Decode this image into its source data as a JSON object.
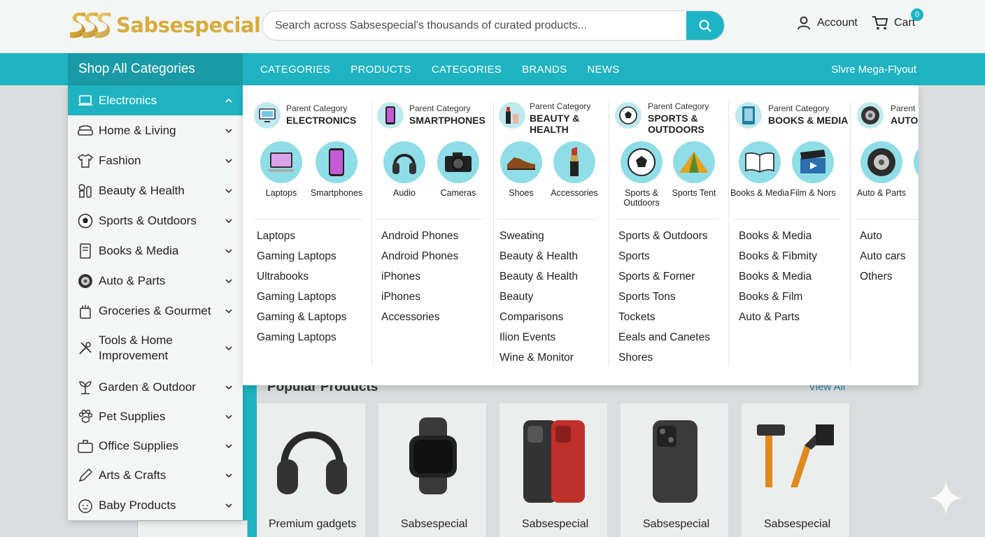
{
  "brand": {
    "name": "Sabsespecial"
  },
  "search": {
    "placeholder": "Search across Sabsespecial's thousands of curated products..."
  },
  "header": {
    "account_label": "Account",
    "cart_label": "Cart",
    "cart_count": "0"
  },
  "nav": {
    "shop_all": "Shop All Categories",
    "links": [
      "CATEGORIES",
      "PRODUCTS",
      "CATEGORIES",
      "BRANDS",
      "NEWS"
    ],
    "right_label": "Slvre Mega-Flyout"
  },
  "sidebar": {
    "items": [
      {
        "label": "Electronics",
        "icon": "laptop-icon"
      },
      {
        "label": "Home & Living",
        "icon": "sofa-icon"
      },
      {
        "label": "Fashion",
        "icon": "shirt-icon"
      },
      {
        "label": "Beauty & Health",
        "icon": "beauty-icon"
      },
      {
        "label": "Sports & Outdoors",
        "icon": "soccer-ball-icon"
      },
      {
        "label": "Books & Media",
        "icon": "book-icon"
      },
      {
        "label": "Auto & Parts",
        "icon": "tire-icon"
      },
      {
        "label": "Groceries & Gourmet",
        "icon": "grocery-bag-icon"
      },
      {
        "label": "Tools & Home Improvement",
        "icon": "tools-icon"
      },
      {
        "label": "Garden & Outdoor",
        "icon": "plant-icon"
      },
      {
        "label": "Pet Supplies",
        "icon": "paw-icon"
      },
      {
        "label": "Office Supplies",
        "icon": "briefcase-icon"
      },
      {
        "label": "Arts & Crafts",
        "icon": "pencil-icon"
      },
      {
        "label": "Baby Products",
        "icon": "baby-icon"
      }
    ]
  },
  "mega": {
    "columns": [
      {
        "parent_small": "Parent Category",
        "parent_name": "ELECTRONICS",
        "parent_icon": "monitor-icon",
        "subs": [
          {
            "label": "Laptops",
            "icon": "laptop-icon"
          },
          {
            "label": "Smartphones",
            "icon": "smartphone-icon"
          }
        ],
        "links": [
          "Laptops",
          "Gaming Laptops",
          "Ultrabooks",
          "Gaming Laptops",
          "Gaming & Laptops",
          "Gaming Laptops"
        ]
      },
      {
        "parent_small": "Parent Category",
        "parent_name": "SMARTPHONES",
        "parent_icon": "smartphone-icon",
        "subs": [
          {
            "label": "Audio",
            "icon": "headphones-icon"
          },
          {
            "label": "Cameras",
            "icon": "camera-icon"
          }
        ],
        "links": [
          "Android Phones",
          "Android Phones",
          "iPhones",
          "iPhones",
          "Accessories"
        ]
      },
      {
        "parent_small": "Parent Category",
        "parent_name": "BEAUTY & HEALTH",
        "parent_icon": "cosmetics-icon",
        "subs": [
          {
            "label": "Shoes",
            "icon": "shoe-icon"
          },
          {
            "label": "Accessories",
            "icon": "lipstick-icon"
          }
        ],
        "links": [
          "Sweating",
          "Beauty & Health",
          "Beauty & Health",
          "Beauty",
          "Comparisons",
          "Ilion Events",
          "Wine & Monitor"
        ]
      },
      {
        "parent_small": "Parent Category",
        "parent_name": "SPORTS & OUTDOORS",
        "parent_icon": "soccer-ball-icon",
        "subs": [
          {
            "label": "Sports & Outdoors",
            "icon": "soccer-ball-icon"
          },
          {
            "label": "Sports Tent",
            "icon": "tent-icon"
          }
        ],
        "links": [
          "Sports & Outdoors",
          "Sports",
          "Sports & Forner",
          "Sports Tons",
          "Tockets",
          "Eeals and Canetes",
          "Shores"
        ]
      },
      {
        "parent_small": "Parent Category",
        "parent_name": "BOOKS & MEDIA",
        "parent_icon": "book-icon",
        "subs": [
          {
            "label": "Books & Media",
            "icon": "open-book-icon"
          },
          {
            "label": "Film & Nors",
            "icon": "clapperboard-icon"
          }
        ],
        "links": [
          "Books & Media",
          "Books & Fibmity",
          "Books & Media",
          "Books & Film",
          "Auto & Parts"
        ]
      },
      {
        "parent_small": "Parent",
        "parent_name": "AUTO",
        "parent_icon": "tire-icon",
        "subs": [
          {
            "label": "Auto & Parts",
            "icon": "tire-icon"
          },
          {
            "label": "",
            "icon": "circle-icon"
          }
        ],
        "links": [
          "Auto",
          "Auto cars",
          "Others"
        ]
      }
    ]
  },
  "popular": {
    "title": "Popular Products",
    "view_all": "View All",
    "cards": [
      {
        "name": "Premium gadgets",
        "icon": "headphones-icon"
      },
      {
        "name": "Sabsespecial",
        "icon": "smartwatch-icon"
      },
      {
        "name": "Sabsespecial",
        "icon": "phone-case-red-icon"
      },
      {
        "name": "Sabsespecial",
        "icon": "phone-case-black-icon"
      },
      {
        "name": "Sabsespecial",
        "icon": "tools-icon"
      }
    ]
  },
  "colors": {
    "accent": "#1fb3c1",
    "accent_dark": "#1a9aa6",
    "brand_gold": "#d8ac3c",
    "pill": "#8fdde6"
  }
}
